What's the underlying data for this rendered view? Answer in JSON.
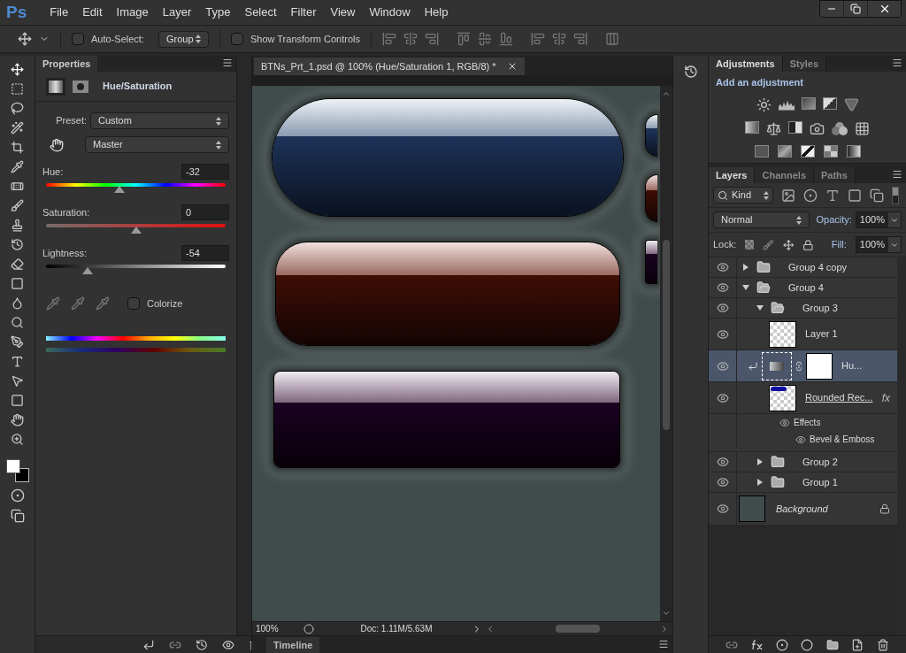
{
  "app": {
    "logo": "Ps"
  },
  "menu": [
    "File",
    "Edit",
    "Image",
    "Layer",
    "Type",
    "Select",
    "Filter",
    "View",
    "Window",
    "Help"
  ],
  "options_bar": {
    "auto_select": {
      "label": "Auto-Select:",
      "checked": false
    },
    "target": "Group",
    "transform_controls": {
      "label": "Show Transform Controls",
      "checked": false
    }
  },
  "properties": {
    "tab": "Properties",
    "title": "Hue/Saturation",
    "preset_label": "Preset:",
    "preset": "Custom",
    "channel": "Master",
    "sliders": [
      {
        "kind": "hue",
        "label": "Hue:",
        "value": "-32",
        "level": 0.41
      },
      {
        "kind": "saturation",
        "label": "Saturation:",
        "value": "0",
        "level": 0.5
      },
      {
        "kind": "lightness",
        "label": "Lightness:",
        "value": "-54",
        "level": 0.23
      }
    ],
    "colorize": {
      "label": "Colorize",
      "checked": false
    }
  },
  "document": {
    "tab": "BTNs_Prt_1.psd @ 100% (Hue/Saturation 1, RGB/8) *",
    "zoom": "100%",
    "doc_info": "Doc: 1.11M/5.63M"
  },
  "timeline": {
    "tab": "Timeline"
  },
  "adjustments": {
    "tabs": [
      {
        "label": "Adjustments",
        "selected": true
      },
      {
        "label": "Styles",
        "selected": false
      }
    ],
    "heading": "Add an adjustment"
  },
  "layers_panel": {
    "tabs": [
      {
        "label": "Layers",
        "selected": true
      },
      {
        "label": "Channels",
        "selected": false
      },
      {
        "label": "Paths",
        "selected": false
      }
    ],
    "filter": "Kind",
    "blend_mode": "Normal",
    "opacity_label": "Opacity:",
    "opacity": "100%",
    "lock_label": "Lock:",
    "fill_label": "Fill:",
    "fill": "100%",
    "layers": [
      {
        "kind": "group",
        "name": "Group 4 copy",
        "selected": false,
        "expanded": false
      },
      {
        "kind": "group",
        "name": "Group 4",
        "selected": false,
        "expanded": true,
        "children": [
          {
            "kind": "group",
            "name": "Group 3",
            "selected": false,
            "expanded": true,
            "children": [
              {
                "kind": "pixel",
                "name": "Layer 1",
                "selected": false
              },
              {
                "kind": "adjustment",
                "name": "Hu...",
                "selected": true,
                "clipped": true
              },
              {
                "kind": "pixel",
                "name": "Rounded Rec...",
                "selected": false,
                "fx": "fx",
                "effects": {
                  "label": "Effects",
                  "items": [
                    "Bevel & Emboss"
                  ]
                }
              }
            ]
          },
          {
            "kind": "group",
            "name": "Group 2",
            "selected": false,
            "expanded": false
          },
          {
            "kind": "group",
            "name": "Group 1",
            "selected": false,
            "expanded": false
          }
        ]
      },
      {
        "kind": "background",
        "name": "Background",
        "selected": false,
        "locked": true
      }
    ]
  }
}
